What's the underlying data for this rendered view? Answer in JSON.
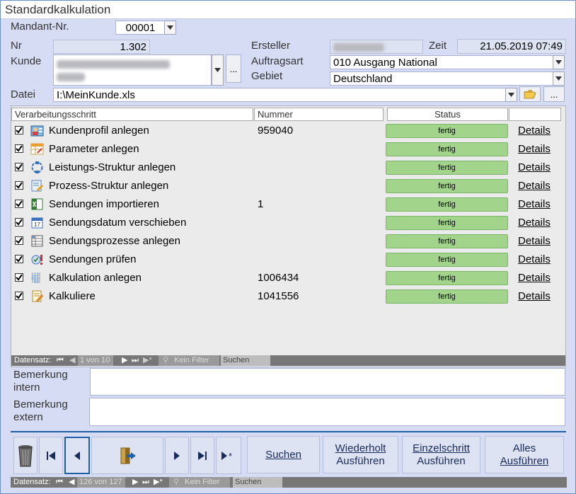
{
  "window": {
    "title": "Standardkalkulation"
  },
  "header": {
    "mandant_label": "Mandant-Nr.",
    "mandant_value": "00001",
    "nr_label": "Nr",
    "nr_value": "1.302",
    "kunde_label": "Kunde",
    "ersteller_label": "Ersteller",
    "zeit_label": "Zeit",
    "zeit_value": "21.05.2019 07:49",
    "auftragsart_label": "Auftragsart",
    "auftragsart_value": "010 Ausgang National",
    "gebiet_label": "Gebiet",
    "gebiet_value": "Deutschland",
    "datei_label": "Datei",
    "datei_value": "I:\\MeinKunde.xls",
    "ellipsis": "...",
    "kunde_btn": "..."
  },
  "grid": {
    "columns": [
      "Verarbeitungsschritt",
      "Nummer",
      "Status"
    ],
    "rows": [
      {
        "checked": true,
        "icon": "user-profile-icon",
        "step": "Kundenprofil anlegen",
        "number": "959040",
        "status": "fertig",
        "link": "Details"
      },
      {
        "checked": true,
        "icon": "parameter-table-icon",
        "step": "Parameter anlegen",
        "number": "",
        "status": "fertig",
        "link": "Details"
      },
      {
        "checked": true,
        "icon": "structure-cycle-icon",
        "step": "Leistungs-Struktur anlegen",
        "number": "",
        "status": "fertig",
        "link": "Details"
      },
      {
        "checked": true,
        "icon": "process-edit-icon",
        "step": "Prozess-Struktur anlegen",
        "number": "",
        "status": "fertig",
        "link": "Details"
      },
      {
        "checked": true,
        "icon": "excel-import-icon",
        "step": "Sendungen importieren",
        "number": "1",
        "status": "fertig",
        "link": "Details"
      },
      {
        "checked": true,
        "icon": "calendar-icon",
        "step": "Sendungsdatum verschieben",
        "number": "",
        "status": "fertig",
        "link": "Details"
      },
      {
        "checked": true,
        "icon": "list-grid-icon",
        "step": "Sendungsprozesse anlegen",
        "number": "",
        "status": "fertig",
        "link": "Details"
      },
      {
        "checked": true,
        "icon": "check-alert-icon",
        "step": "Sendungen prüfen",
        "number": "",
        "status": "fertig",
        "link": "Details"
      },
      {
        "checked": true,
        "icon": "calc-numbers-icon",
        "step": "Kalkulation anlegen",
        "number": "1006434",
        "status": "fertig",
        "link": "Details"
      },
      {
        "checked": true,
        "icon": "calculate-note-icon",
        "step": "Kalkuliere",
        "number": "1041556",
        "status": "fertig",
        "link": "Details"
      }
    ],
    "nav": {
      "label": "Datensatz:",
      "position": "1 von 10",
      "filter": "Kein Filter",
      "search": "Suchen"
    }
  },
  "memo": {
    "intern_label_1": "Bemerkung",
    "intern_label_2": "intern",
    "extern_label_1": "Bemerkung",
    "extern_label_2": "extern"
  },
  "actions": {
    "suchen": "Suchen",
    "wiederholt_1": "Wiederholt",
    "wiederholt_2": "Ausführen",
    "einzelschritt_1": "Einzelschritt",
    "einzelschritt_2": "Ausführen",
    "alles_1": "Alles",
    "alles_2": "Ausführen"
  },
  "form_nav": {
    "label": "Datensatz:",
    "position": "126 von 127",
    "filter": "Kein Filter",
    "search": "Suchen"
  },
  "colors": {
    "status_green": "#a2d58b",
    "form_bg": "#d5dcf4",
    "accent": "#1f5fa8"
  }
}
